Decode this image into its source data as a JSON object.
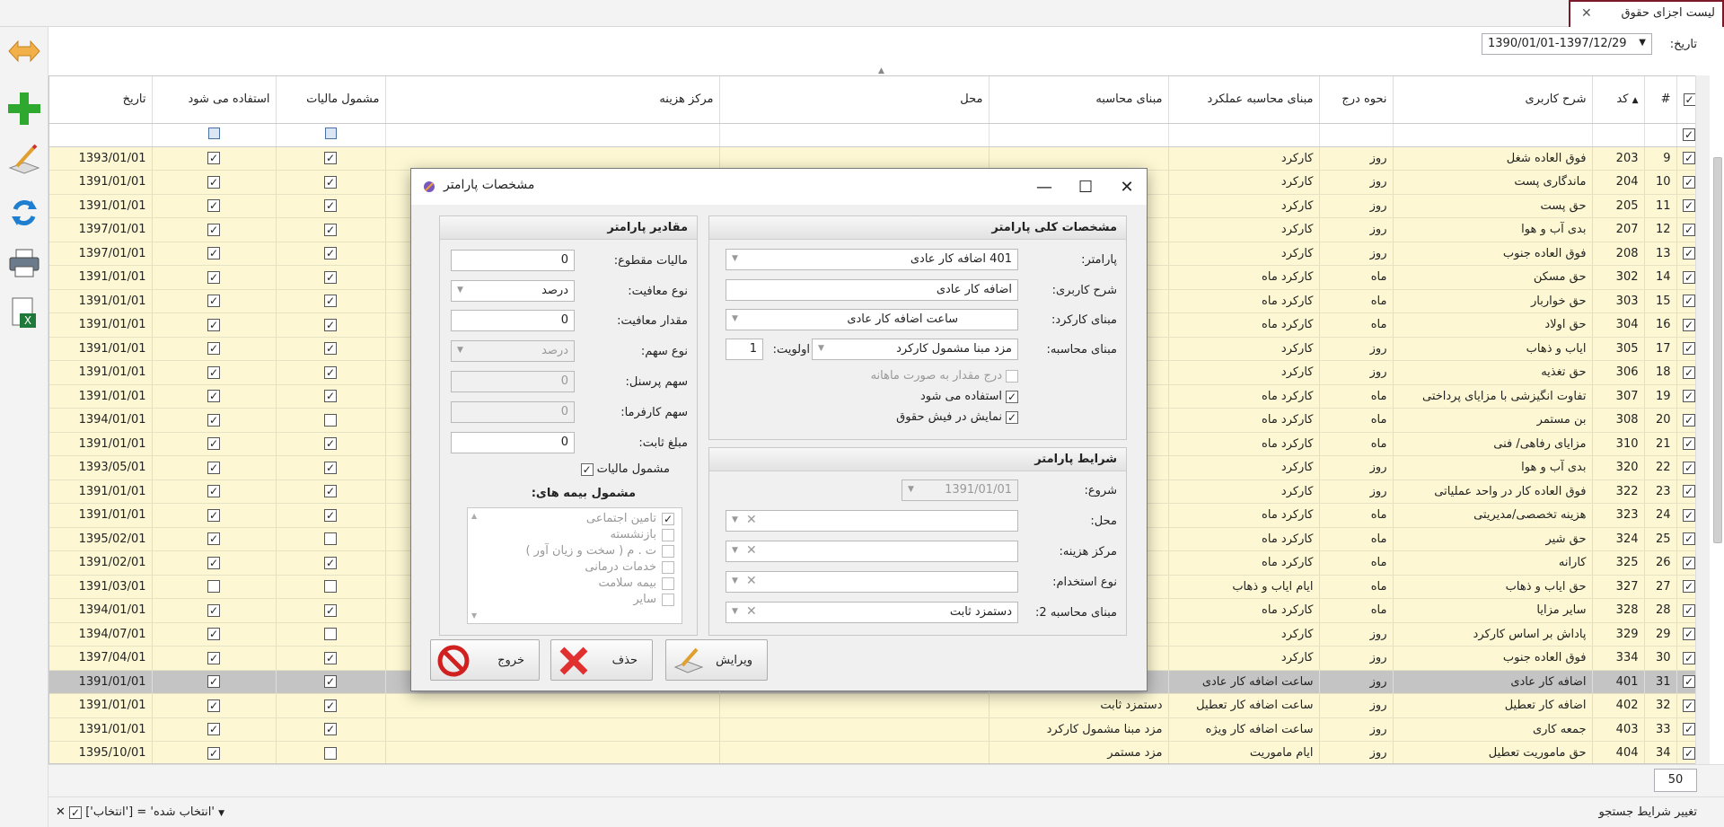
{
  "tab": {
    "title": "لیست اجزای حقوق"
  },
  "filter": {
    "date_label": "تاریخ:",
    "date_value": "1390/01/01-1397/12/29"
  },
  "grid": {
    "columns": [
      "",
      "#",
      "کد",
      "شرح کاربری",
      "نحوه درج",
      "مبنای محاسبه عملکرد",
      "مبنای محاسبه",
      "محل",
      "مرکز هزینه",
      "مشمول مالیات",
      "استفاده می شود",
      "تاریخ"
    ],
    "rows": [
      {
        "n": "9",
        "code": "203",
        "desc": "فوق العاده شغل",
        "ins": "روز",
        "perf": "کارکرد",
        "calc": "",
        "tax": true,
        "used": true,
        "date": "1393/01/01"
      },
      {
        "n": "10",
        "code": "204",
        "desc": "ماندگاری پست",
        "ins": "روز",
        "perf": "کارکرد",
        "calc": "",
        "tax": true,
        "used": true,
        "date": "1391/01/01"
      },
      {
        "n": "11",
        "code": "205",
        "desc": "حق پست",
        "ins": "روز",
        "perf": "کارکرد",
        "calc": "",
        "tax": true,
        "used": true,
        "date": "1391/01/01"
      },
      {
        "n": "12",
        "code": "207",
        "desc": "بدی آب و هوا",
        "ins": "روز",
        "perf": "کارکرد",
        "calc": "",
        "tax": true,
        "used": true,
        "date": "1397/01/01"
      },
      {
        "n": "13",
        "code": "208",
        "desc": "فوق العاده جنوب",
        "ins": "روز",
        "perf": "کارکرد",
        "calc": "",
        "tax": true,
        "used": true,
        "date": "1397/01/01"
      },
      {
        "n": "14",
        "code": "302",
        "desc": "حق مسکن",
        "ins": "ماه",
        "perf": "کارکرد ماه",
        "calc": "",
        "tax": true,
        "used": true,
        "date": "1391/01/01"
      },
      {
        "n": "15",
        "code": "303",
        "desc": "حق خواربار",
        "ins": "ماه",
        "perf": "کارکرد ماه",
        "calc": "",
        "tax": true,
        "used": true,
        "date": "1391/01/01"
      },
      {
        "n": "16",
        "code": "304",
        "desc": "حق اولاد",
        "ins": "ماه",
        "perf": "کارکرد ماه",
        "calc": "",
        "tax": true,
        "used": true,
        "date": "1391/01/01"
      },
      {
        "n": "17",
        "code": "305",
        "desc": "ایاب و ذهاب",
        "ins": "روز",
        "perf": "کارکرد",
        "calc": "",
        "tax": true,
        "used": true,
        "date": "1391/01/01"
      },
      {
        "n": "18",
        "code": "306",
        "desc": "حق تغذیه",
        "ins": "روز",
        "perf": "کارکرد",
        "calc": "",
        "tax": true,
        "used": true,
        "date": "1391/01/01"
      },
      {
        "n": "19",
        "code": "307",
        "desc": "تفاوت انگیزشی با مزایای پرداختی",
        "ins": "ماه",
        "perf": "کارکرد ماه",
        "calc": "",
        "tax": true,
        "used": true,
        "date": "1391/01/01"
      },
      {
        "n": "20",
        "code": "308",
        "desc": "بن مستمر",
        "ins": "ماه",
        "perf": "کارکرد ماه",
        "calc": "",
        "tax": false,
        "used": true,
        "date": "1394/01/01"
      },
      {
        "n": "21",
        "code": "310",
        "desc": "مزایای رفاهی/ فنی",
        "ins": "ماه",
        "perf": "کارکرد ماه",
        "calc": "",
        "tax": true,
        "used": true,
        "date": "1391/01/01"
      },
      {
        "n": "22",
        "code": "320",
        "desc": "بدی آب و هوا",
        "ins": "روز",
        "perf": "کارکرد",
        "calc": "",
        "tax": true,
        "used": true,
        "date": "1393/05/01"
      },
      {
        "n": "23",
        "code": "322",
        "desc": "فوق العاده کار در واحد عملیاتی",
        "ins": "روز",
        "perf": "کارکرد",
        "calc": "",
        "tax": true,
        "used": true,
        "date": "1391/01/01"
      },
      {
        "n": "24",
        "code": "323",
        "desc": "هزینه تخصصی/مدیریتی",
        "ins": "ماه",
        "perf": "کارکرد ماه",
        "calc": "",
        "tax": true,
        "used": true,
        "date": "1391/01/01"
      },
      {
        "n": "25",
        "code": "324",
        "desc": "حق شیر",
        "ins": "ماه",
        "perf": "کارکرد ماه",
        "calc": "",
        "tax": false,
        "used": true,
        "date": "1395/02/01"
      },
      {
        "n": "26",
        "code": "325",
        "desc": "کارانه",
        "ins": "ماه",
        "perf": "کارکرد ماه",
        "calc": "",
        "tax": true,
        "used": true,
        "date": "1391/02/01"
      },
      {
        "n": "27",
        "code": "327",
        "desc": "حق ایاب و ذهاب",
        "ins": "ماه",
        "perf": "ایام ایاب و ذهاب",
        "calc": "",
        "tax": false,
        "used": false,
        "date": "1391/03/01"
      },
      {
        "n": "28",
        "code": "328",
        "desc": "سایر مزایا",
        "ins": "ماه",
        "perf": "کارکرد ماه",
        "calc": "",
        "tax": true,
        "used": true,
        "date": "1394/01/01"
      },
      {
        "n": "29",
        "code": "329",
        "desc": "پاداش بر اساس کارکرد",
        "ins": "روز",
        "perf": "کارکرد",
        "calc": "",
        "tax": false,
        "used": true,
        "date": "1394/07/01"
      },
      {
        "n": "30",
        "code": "334",
        "desc": "فوق العاده جنوب",
        "ins": "روز",
        "perf": "کارکرد",
        "calc": "",
        "tax": true,
        "used": true,
        "date": "1397/04/01"
      },
      {
        "n": "31",
        "code": "401",
        "desc": "اضافه کار عادی",
        "ins": "روز",
        "perf": "ساعت اضافه کار عادی",
        "calc": "",
        "tax": true,
        "used": true,
        "date": "1391/01/01",
        "sel": true
      },
      {
        "n": "32",
        "code": "402",
        "desc": "اضافه کار تعطیل",
        "ins": "روز",
        "perf": "ساعت اضافه کار تعطیل",
        "calc": "دستمزد ثابت",
        "tax": true,
        "used": true,
        "date": "1391/01/01"
      },
      {
        "n": "33",
        "code": "403",
        "desc": "جمعه کاری",
        "ins": "روز",
        "perf": "ساعت اضافه کار ویژه",
        "calc": "مزد مبنا مشمول کارکرد",
        "tax": true,
        "used": true,
        "date": "1391/01/01"
      },
      {
        "n": "34",
        "code": "404",
        "desc": "حق ماموریت تعطیل",
        "ins": "روز",
        "perf": "ایام ماموریت",
        "calc": "مزد مستمر",
        "tax": false,
        "used": true,
        "date": "1395/10/01"
      }
    ]
  },
  "pager": {
    "page_size": "50"
  },
  "footer": {
    "change_search": "تغییر شرایط جستجو",
    "filter_expression": "['انتخاب'] = 'انتخاب شده'"
  },
  "dialog": {
    "title": "مشخصات پارامتر",
    "general": {
      "header": "مشخصات کلی پارامتر",
      "param_label": "پارامتر:",
      "param_value": "401 اضافه کار عادی",
      "desc_label": "شرح کاربری:",
      "desc_value": "اضافه کار عادی",
      "perf_label": "مبنای کارکرد:",
      "perf_value": "ساعت اضافه کار عادی",
      "calc_label": "مبنای محاسبه:",
      "calc_value": "مزد مبنا مشمول کارکرد",
      "priority_label": "اولویت:",
      "priority_value": "1",
      "monthly_label": "درج مقدار به صورت ماهانه",
      "used_label": "استفاده می شود",
      "show_label": "نمایش در فیش حقوق"
    },
    "conditions": {
      "header": "شرایط پارامتر",
      "start_label": "شروع:",
      "start_value": "1391/01/01",
      "place_label": "محل:",
      "cost_label": "مرکز هزینه:",
      "emp_label": "نوع استخدام:",
      "calc2_label": "مبنای محاسبه 2:",
      "calc2_value": "دستمزد ثابت"
    },
    "values": {
      "header": "مقادیر پارامتر",
      "tax_label": "مالیات مقطوع:",
      "tax_value": "0",
      "exempt_type_label": "نوع معافیت:",
      "exempt_type_value": "درصد",
      "exempt_amount_label": "مقدار معافیت:",
      "exempt_amount_value": "0",
      "share_type_label": "نوع سهم:",
      "share_type_value": "درصد",
      "staff_share_label": "سهم پرسنل:",
      "staff_share_value": "0",
      "employer_share_label": "سهم کارفرما:",
      "employer_share_value": "0",
      "fixed_label": "مبلغ ثابت:",
      "fixed_value": "0",
      "taxable_label": "مشمول مالیات",
      "insurance_label": "مشمول بیمه های:",
      "insurance_items": [
        "تامین اجتماعی",
        "بازنشسته",
        "ت . م ( سخت و زیان آور )",
        "خدمات درمانی",
        "بیمه سلامت",
        "سایر"
      ]
    },
    "buttons": {
      "edit": "ویرایش",
      "delete": "حذف",
      "exit": "خروج"
    }
  }
}
